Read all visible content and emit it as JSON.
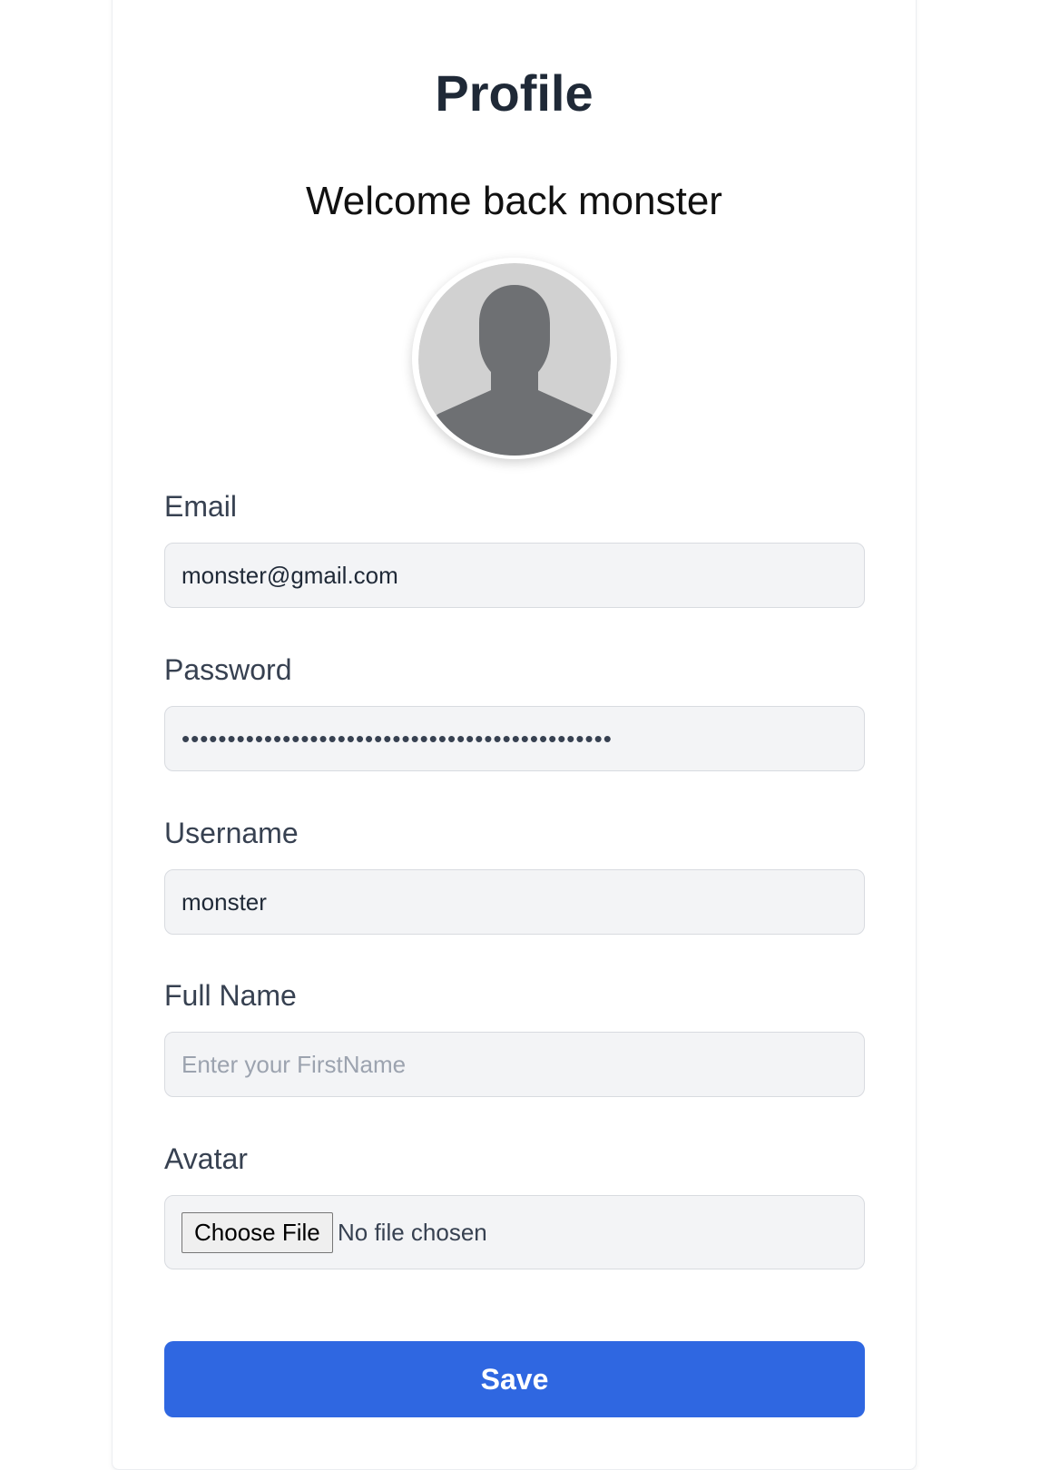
{
  "page": {
    "title": "Profile",
    "welcome": "Welcome back monster"
  },
  "avatar": {
    "icon": "default-user-silhouette-icon",
    "bg_color": "#d1d1d1",
    "figure_color": "#6e7073"
  },
  "form": {
    "email": {
      "label": "Email",
      "value": "monster@gmail.com"
    },
    "password": {
      "label": "Password",
      "masked_value": "•••••••••••••••••••••••••••••••••••••••••••••••"
    },
    "username": {
      "label": "Username",
      "value": "monster"
    },
    "full_name": {
      "label": "Full Name",
      "value": "",
      "placeholder": "Enter your FirstName"
    },
    "avatar": {
      "label": "Avatar",
      "button_label": "Choose File",
      "status": "No file chosen"
    }
  },
  "save_button": {
    "label": "Save",
    "color": "#2f67e1"
  }
}
